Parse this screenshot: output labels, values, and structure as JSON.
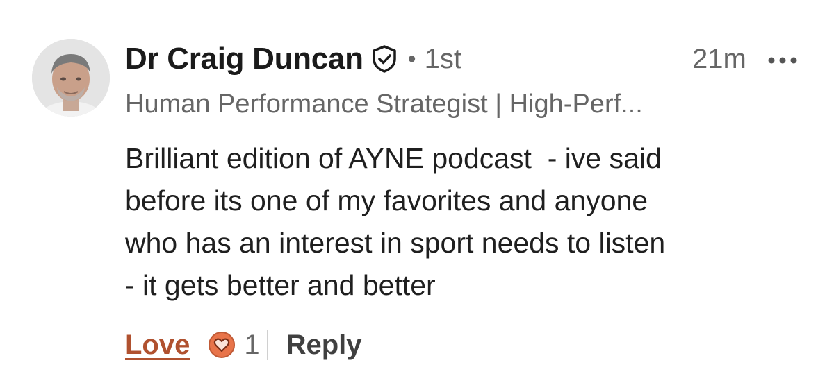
{
  "comment": {
    "author": {
      "name": "Dr Craig Duncan",
      "verified_icon": "shield-check-icon",
      "separator": "•",
      "connection_degree": "1st",
      "headline": "Human Performance Strategist | High-Perf..."
    },
    "timestamp": "21m",
    "more_icon": "ellipsis-icon",
    "body_lines": [
      "Brilliant edition of AYNE podcast  - ive said",
      "before its one of my favorites and anyone",
      "who has an interest in sport needs to listen",
      "- it gets better and better"
    ],
    "actions": {
      "love_label": "Love",
      "reaction_icon": "heart-reaction-icon",
      "reaction_count": "1",
      "reply_label": "Reply"
    }
  },
  "colors": {
    "love_accent": "#b0512f",
    "reaction_badge": "#e8744a",
    "muted_text": "#666666"
  }
}
